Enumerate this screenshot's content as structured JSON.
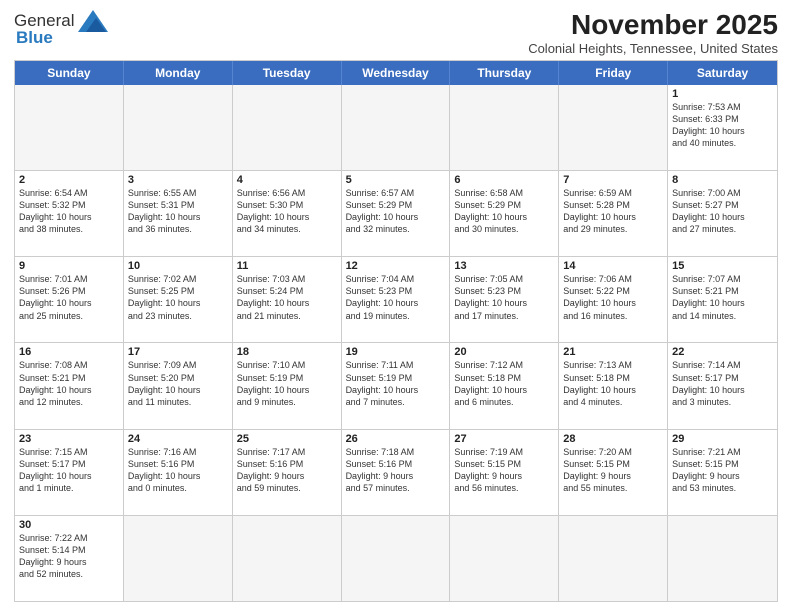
{
  "logo": {
    "line1": "General",
    "line2": "Blue"
  },
  "title": "November 2025",
  "subtitle": "Colonial Heights, Tennessee, United States",
  "days": [
    "Sunday",
    "Monday",
    "Tuesday",
    "Wednesday",
    "Thursday",
    "Friday",
    "Saturday"
  ],
  "rows": [
    [
      {
        "day": "",
        "text": ""
      },
      {
        "day": "",
        "text": ""
      },
      {
        "day": "",
        "text": ""
      },
      {
        "day": "",
        "text": ""
      },
      {
        "day": "",
        "text": ""
      },
      {
        "day": "",
        "text": ""
      },
      {
        "day": "1",
        "text": "Sunrise: 7:53 AM\nSunset: 6:33 PM\nDaylight: 10 hours\nand 40 minutes."
      }
    ],
    [
      {
        "day": "2",
        "text": "Sunrise: 6:54 AM\nSunset: 5:32 PM\nDaylight: 10 hours\nand 38 minutes."
      },
      {
        "day": "3",
        "text": "Sunrise: 6:55 AM\nSunset: 5:31 PM\nDaylight: 10 hours\nand 36 minutes."
      },
      {
        "day": "4",
        "text": "Sunrise: 6:56 AM\nSunset: 5:30 PM\nDaylight: 10 hours\nand 34 minutes."
      },
      {
        "day": "5",
        "text": "Sunrise: 6:57 AM\nSunset: 5:29 PM\nDaylight: 10 hours\nand 32 minutes."
      },
      {
        "day": "6",
        "text": "Sunrise: 6:58 AM\nSunset: 5:29 PM\nDaylight: 10 hours\nand 30 minutes."
      },
      {
        "day": "7",
        "text": "Sunrise: 6:59 AM\nSunset: 5:28 PM\nDaylight: 10 hours\nand 29 minutes."
      },
      {
        "day": "8",
        "text": "Sunrise: 7:00 AM\nSunset: 5:27 PM\nDaylight: 10 hours\nand 27 minutes."
      }
    ],
    [
      {
        "day": "9",
        "text": "Sunrise: 7:01 AM\nSunset: 5:26 PM\nDaylight: 10 hours\nand 25 minutes."
      },
      {
        "day": "10",
        "text": "Sunrise: 7:02 AM\nSunset: 5:25 PM\nDaylight: 10 hours\nand 23 minutes."
      },
      {
        "day": "11",
        "text": "Sunrise: 7:03 AM\nSunset: 5:24 PM\nDaylight: 10 hours\nand 21 minutes."
      },
      {
        "day": "12",
        "text": "Sunrise: 7:04 AM\nSunset: 5:23 PM\nDaylight: 10 hours\nand 19 minutes."
      },
      {
        "day": "13",
        "text": "Sunrise: 7:05 AM\nSunset: 5:23 PM\nDaylight: 10 hours\nand 17 minutes."
      },
      {
        "day": "14",
        "text": "Sunrise: 7:06 AM\nSunset: 5:22 PM\nDaylight: 10 hours\nand 16 minutes."
      },
      {
        "day": "15",
        "text": "Sunrise: 7:07 AM\nSunset: 5:21 PM\nDaylight: 10 hours\nand 14 minutes."
      }
    ],
    [
      {
        "day": "16",
        "text": "Sunrise: 7:08 AM\nSunset: 5:21 PM\nDaylight: 10 hours\nand 12 minutes."
      },
      {
        "day": "17",
        "text": "Sunrise: 7:09 AM\nSunset: 5:20 PM\nDaylight: 10 hours\nand 11 minutes."
      },
      {
        "day": "18",
        "text": "Sunrise: 7:10 AM\nSunset: 5:19 PM\nDaylight: 10 hours\nand 9 minutes."
      },
      {
        "day": "19",
        "text": "Sunrise: 7:11 AM\nSunset: 5:19 PM\nDaylight: 10 hours\nand 7 minutes."
      },
      {
        "day": "20",
        "text": "Sunrise: 7:12 AM\nSunset: 5:18 PM\nDaylight: 10 hours\nand 6 minutes."
      },
      {
        "day": "21",
        "text": "Sunrise: 7:13 AM\nSunset: 5:18 PM\nDaylight: 10 hours\nand 4 minutes."
      },
      {
        "day": "22",
        "text": "Sunrise: 7:14 AM\nSunset: 5:17 PM\nDaylight: 10 hours\nand 3 minutes."
      }
    ],
    [
      {
        "day": "23",
        "text": "Sunrise: 7:15 AM\nSunset: 5:17 PM\nDaylight: 10 hours\nand 1 minute."
      },
      {
        "day": "24",
        "text": "Sunrise: 7:16 AM\nSunset: 5:16 PM\nDaylight: 10 hours\nand 0 minutes."
      },
      {
        "day": "25",
        "text": "Sunrise: 7:17 AM\nSunset: 5:16 PM\nDaylight: 9 hours\nand 59 minutes."
      },
      {
        "day": "26",
        "text": "Sunrise: 7:18 AM\nSunset: 5:16 PM\nDaylight: 9 hours\nand 57 minutes."
      },
      {
        "day": "27",
        "text": "Sunrise: 7:19 AM\nSunset: 5:15 PM\nDaylight: 9 hours\nand 56 minutes."
      },
      {
        "day": "28",
        "text": "Sunrise: 7:20 AM\nSunset: 5:15 PM\nDaylight: 9 hours\nand 55 minutes."
      },
      {
        "day": "29",
        "text": "Sunrise: 7:21 AM\nSunset: 5:15 PM\nDaylight: 9 hours\nand 53 minutes."
      }
    ],
    [
      {
        "day": "30",
        "text": "Sunrise: 7:22 AM\nSunset: 5:14 PM\nDaylight: 9 hours\nand 52 minutes."
      },
      {
        "day": "",
        "text": ""
      },
      {
        "day": "",
        "text": ""
      },
      {
        "day": "",
        "text": ""
      },
      {
        "day": "",
        "text": ""
      },
      {
        "day": "",
        "text": ""
      },
      {
        "day": "",
        "text": ""
      }
    ]
  ]
}
